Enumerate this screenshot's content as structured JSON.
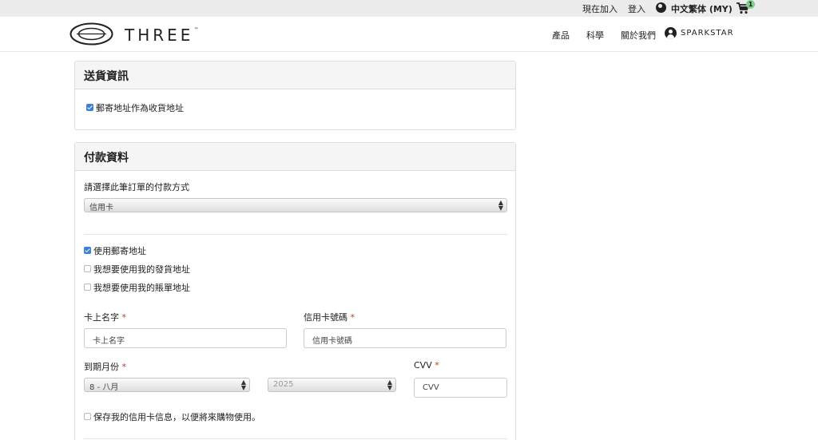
{
  "topbar": {
    "join": "現在加入",
    "login": "登入",
    "language": "中文繁体 (MY)",
    "cart_count": "1"
  },
  "header": {
    "brand": "THREE",
    "brand_tm": "™",
    "nav": [
      "產品",
      "科學",
      "關於我們"
    ],
    "user": "SPARKSTAR"
  },
  "shipping": {
    "title": "送貨資訊",
    "use_mailing_label": "郵寄地址作為收貨地址",
    "use_mailing_checked": true
  },
  "payment": {
    "title": "付款資料",
    "method_label": "請選擇此筆訂單的付款方式",
    "method_value": "信用卡",
    "address_options": [
      {
        "label": "使用郵寄地址",
        "checked": true
      },
      {
        "label": "我想要使用我的發貨地址",
        "checked": false
      },
      {
        "label": "我想要使用我的賬單地址",
        "checked": false
      }
    ],
    "card_name_label": "卡上名字",
    "card_name_placeholder": "卡上名字",
    "card_number_label": "信用卡號碼",
    "card_number_placeholder": "信用卡號碼",
    "expiry_label": "到期月份",
    "expiry_month": "8 - 八月",
    "expiry_year": "2025",
    "cvv_label": "CVV",
    "cvv_placeholder": "CVV",
    "required_mark": "*",
    "save_card_label": "保存我的信用卡信息，以便將來購物使用。",
    "save_card_checked": false
  },
  "colors": {
    "topbar_bg": "#ececec",
    "panel_head_bg": "#f5f5f5",
    "checkbox_on": "#3b82d6",
    "required": "#c0392b",
    "cart_badge": "#7bd08a"
  },
  "icons": [
    "globe-icon",
    "cart-icon",
    "user-icon",
    "select-arrows-icon"
  ]
}
